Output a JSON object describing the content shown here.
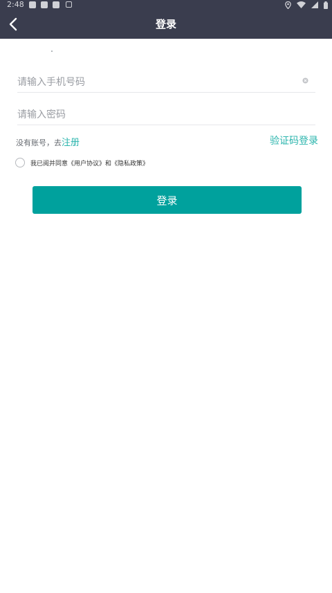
{
  "status_bar": {
    "time": "2:48",
    "notification_icons": [
      "notification-icon",
      "notification-icon",
      "notification-icon",
      "a-notification-icon"
    ],
    "right_icons": [
      "location-icon",
      "wifi-icon",
      "signal-icon",
      "battery-icon"
    ]
  },
  "header": {
    "title": "登录",
    "back_icon": "chevron-left-icon",
    "background": "#3a3d4e"
  },
  "form": {
    "phone_placeholder": "请输入手机号码",
    "phone_value": "",
    "password_placeholder": "请输入密码",
    "password_value": "",
    "clear_icon": "clear-circle-icon"
  },
  "links": {
    "no_account_text": "没有账号，去",
    "register_label": "注册",
    "sms_login_label": "验证码登录"
  },
  "agreement": {
    "checked": false,
    "prefix": "我已阅并同意",
    "user_agreement": "《用户协议》",
    "conjunction": "和",
    "privacy_policy": "《隐私政策》"
  },
  "actions": {
    "login_label": "登录"
  },
  "colors": {
    "accent": "#2bb5ad",
    "button": "#00a19d"
  }
}
